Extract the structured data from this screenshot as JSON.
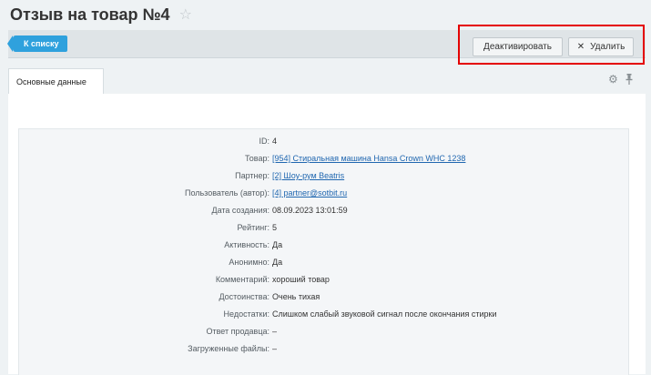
{
  "page": {
    "title": "Отзыв на товар №4"
  },
  "toolbar": {
    "back_label": "К списку",
    "deactivate_label": "Деактивировать",
    "delete_label": "Удалить"
  },
  "tabs": {
    "main_label": "Основные данные"
  },
  "details": {
    "id_label": "ID:",
    "id_value": "4",
    "product_label": "Товар:",
    "product_value": "[954] Стиральная машина Hansa Crown WHC 1238",
    "partner_label": "Партнер:",
    "partner_value": "[2] Шоу-рум Beatris",
    "user_label": "Пользователь (автор):",
    "user_value": "[4] partner@sotbit.ru",
    "created_label": "Дата создания:",
    "created_value": "08.09.2023 13:01:59",
    "rating_label": "Рейтинг:",
    "rating_value": "5",
    "active_label": "Активность:",
    "active_value": "Да",
    "anonymous_label": "Анонимно:",
    "anonymous_value": "Да",
    "comment_label": "Комментарий:",
    "comment_value": "хороший товар",
    "pros_label": "Достоинства:",
    "pros_value": "Очень тихая",
    "cons_label": "Недостатки:",
    "cons_value": "Слишком слабый звуковой сигнал после окончания стирки",
    "reply_label": "Ответ продавца:",
    "reply_value": "–",
    "files_label": "Загруженные файлы:",
    "files_value": "–"
  },
  "icons": {
    "favorite": "star-icon",
    "delete": "close-icon",
    "settings": "gear-icon",
    "pin": "pin-icon"
  },
  "colors": {
    "accent": "#2fa1dd",
    "highlight": "#e40000",
    "link": "#2067b0"
  }
}
